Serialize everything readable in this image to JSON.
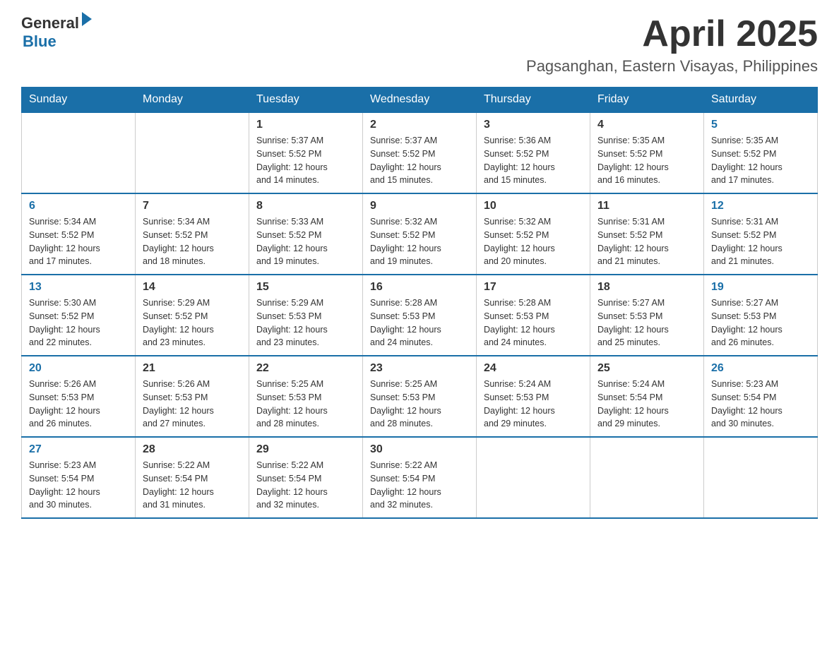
{
  "logo": {
    "general": "General",
    "blue": "Blue"
  },
  "title": "April 2025",
  "location": "Pagsanghan, Eastern Visayas, Philippines",
  "days_of_week": [
    "Sunday",
    "Monday",
    "Tuesday",
    "Wednesday",
    "Thursday",
    "Friday",
    "Saturday"
  ],
  "weeks": [
    [
      {
        "day": "",
        "info": ""
      },
      {
        "day": "",
        "info": ""
      },
      {
        "day": "1",
        "info": "Sunrise: 5:37 AM\nSunset: 5:52 PM\nDaylight: 12 hours\nand 14 minutes."
      },
      {
        "day": "2",
        "info": "Sunrise: 5:37 AM\nSunset: 5:52 PM\nDaylight: 12 hours\nand 15 minutes."
      },
      {
        "day": "3",
        "info": "Sunrise: 5:36 AM\nSunset: 5:52 PM\nDaylight: 12 hours\nand 15 minutes."
      },
      {
        "day": "4",
        "info": "Sunrise: 5:35 AM\nSunset: 5:52 PM\nDaylight: 12 hours\nand 16 minutes."
      },
      {
        "day": "5",
        "info": "Sunrise: 5:35 AM\nSunset: 5:52 PM\nDaylight: 12 hours\nand 17 minutes."
      }
    ],
    [
      {
        "day": "6",
        "info": "Sunrise: 5:34 AM\nSunset: 5:52 PM\nDaylight: 12 hours\nand 17 minutes."
      },
      {
        "day": "7",
        "info": "Sunrise: 5:34 AM\nSunset: 5:52 PM\nDaylight: 12 hours\nand 18 minutes."
      },
      {
        "day": "8",
        "info": "Sunrise: 5:33 AM\nSunset: 5:52 PM\nDaylight: 12 hours\nand 19 minutes."
      },
      {
        "day": "9",
        "info": "Sunrise: 5:32 AM\nSunset: 5:52 PM\nDaylight: 12 hours\nand 19 minutes."
      },
      {
        "day": "10",
        "info": "Sunrise: 5:32 AM\nSunset: 5:52 PM\nDaylight: 12 hours\nand 20 minutes."
      },
      {
        "day": "11",
        "info": "Sunrise: 5:31 AM\nSunset: 5:52 PM\nDaylight: 12 hours\nand 21 minutes."
      },
      {
        "day": "12",
        "info": "Sunrise: 5:31 AM\nSunset: 5:52 PM\nDaylight: 12 hours\nand 21 minutes."
      }
    ],
    [
      {
        "day": "13",
        "info": "Sunrise: 5:30 AM\nSunset: 5:52 PM\nDaylight: 12 hours\nand 22 minutes."
      },
      {
        "day": "14",
        "info": "Sunrise: 5:29 AM\nSunset: 5:52 PM\nDaylight: 12 hours\nand 23 minutes."
      },
      {
        "day": "15",
        "info": "Sunrise: 5:29 AM\nSunset: 5:53 PM\nDaylight: 12 hours\nand 23 minutes."
      },
      {
        "day": "16",
        "info": "Sunrise: 5:28 AM\nSunset: 5:53 PM\nDaylight: 12 hours\nand 24 minutes."
      },
      {
        "day": "17",
        "info": "Sunrise: 5:28 AM\nSunset: 5:53 PM\nDaylight: 12 hours\nand 24 minutes."
      },
      {
        "day": "18",
        "info": "Sunrise: 5:27 AM\nSunset: 5:53 PM\nDaylight: 12 hours\nand 25 minutes."
      },
      {
        "day": "19",
        "info": "Sunrise: 5:27 AM\nSunset: 5:53 PM\nDaylight: 12 hours\nand 26 minutes."
      }
    ],
    [
      {
        "day": "20",
        "info": "Sunrise: 5:26 AM\nSunset: 5:53 PM\nDaylight: 12 hours\nand 26 minutes."
      },
      {
        "day": "21",
        "info": "Sunrise: 5:26 AM\nSunset: 5:53 PM\nDaylight: 12 hours\nand 27 minutes."
      },
      {
        "day": "22",
        "info": "Sunrise: 5:25 AM\nSunset: 5:53 PM\nDaylight: 12 hours\nand 28 minutes."
      },
      {
        "day": "23",
        "info": "Sunrise: 5:25 AM\nSunset: 5:53 PM\nDaylight: 12 hours\nand 28 minutes."
      },
      {
        "day": "24",
        "info": "Sunrise: 5:24 AM\nSunset: 5:53 PM\nDaylight: 12 hours\nand 29 minutes."
      },
      {
        "day": "25",
        "info": "Sunrise: 5:24 AM\nSunset: 5:54 PM\nDaylight: 12 hours\nand 29 minutes."
      },
      {
        "day": "26",
        "info": "Sunrise: 5:23 AM\nSunset: 5:54 PM\nDaylight: 12 hours\nand 30 minutes."
      }
    ],
    [
      {
        "day": "27",
        "info": "Sunrise: 5:23 AM\nSunset: 5:54 PM\nDaylight: 12 hours\nand 30 minutes."
      },
      {
        "day": "28",
        "info": "Sunrise: 5:22 AM\nSunset: 5:54 PM\nDaylight: 12 hours\nand 31 minutes."
      },
      {
        "day": "29",
        "info": "Sunrise: 5:22 AM\nSunset: 5:54 PM\nDaylight: 12 hours\nand 32 minutes."
      },
      {
        "day": "30",
        "info": "Sunrise: 5:22 AM\nSunset: 5:54 PM\nDaylight: 12 hours\nand 32 minutes."
      },
      {
        "day": "",
        "info": ""
      },
      {
        "day": "",
        "info": ""
      },
      {
        "day": "",
        "info": ""
      }
    ]
  ]
}
